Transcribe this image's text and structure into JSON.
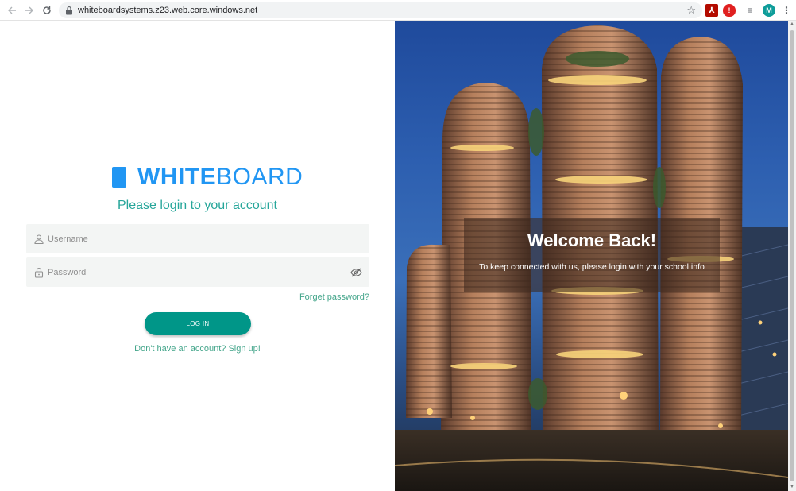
{
  "browser": {
    "back_icon": "arrow-left-icon",
    "forward_icon": "arrow-right-icon",
    "reload_icon": "reload-icon",
    "url": "whiteboardsystems.z23.web.core.windows.net",
    "avatar_letter": "M"
  },
  "login": {
    "logo_part1": "WHITE",
    "logo_part2": "BOARD",
    "subtitle": "Please login to your account",
    "username_placeholder": "Username",
    "password_placeholder": "Password",
    "forgot_password": "Forget password?",
    "login_button": "LOG IN",
    "signup_text": "Don't have an account? Sign up!"
  },
  "hero": {
    "title": "Welcome Back!",
    "subtitle": "To keep connected with us, please login with your school info"
  },
  "colors": {
    "brand": "#2196f3",
    "accent": "#009688",
    "link": "#43a58a"
  }
}
